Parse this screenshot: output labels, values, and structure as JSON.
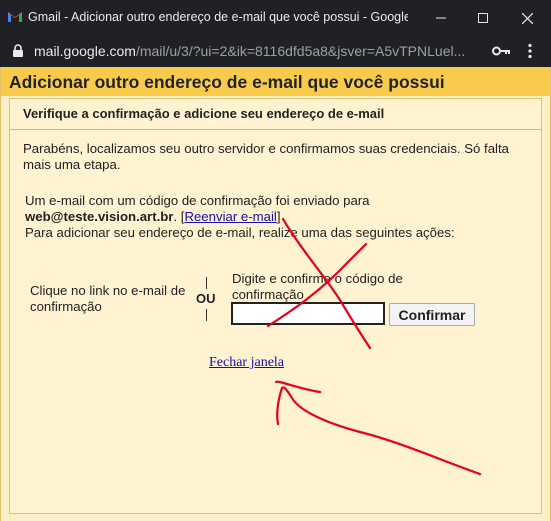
{
  "window": {
    "title": "Gmail - Adicionar outro endereço de e-mail que você possui - Google...",
    "controls": {
      "minimize": "minimize-icon",
      "maximize": "maximize-icon",
      "close": "close-icon"
    }
  },
  "addressbar": {
    "host": "mail.google.com",
    "path": "/mail/u/3/?ui=2&ik=8116dfd5a8&jsver=A5vTPNLuel..."
  },
  "dialog": {
    "title": "Adicionar outro endereço de e-mail que você possui",
    "subtitle": "Verifique a confirmação e adicione seu endereço de e-mail",
    "paragraph1": "Parabéns, localizamos seu outro servidor e confirmamos suas credenciais. Só falta mais uma etapa.",
    "sent_text": "Um e-mail com um código de confirmação foi enviado para",
    "email": "web@teste.vision.art.br",
    "email_suffix": ".",
    "open_bracket": "[",
    "resend_link": "Reenviar e-mail",
    "close_bracket": "]",
    "instruction": "Para adicionar seu endereço de e-mail, realize uma das seguintes ações:",
    "option1": "Clique no link no e-mail de confirmação",
    "or": "OU",
    "option2": "Digite e confirme o código de confirmação",
    "code_value": "",
    "confirm_button": "Confirmar",
    "close_link": "Fechar janela"
  },
  "colors": {
    "titlebar": "#202124",
    "dialog_header": "#f8cb4d",
    "panel": "#fff3d1",
    "annotation": "#e8001c"
  }
}
